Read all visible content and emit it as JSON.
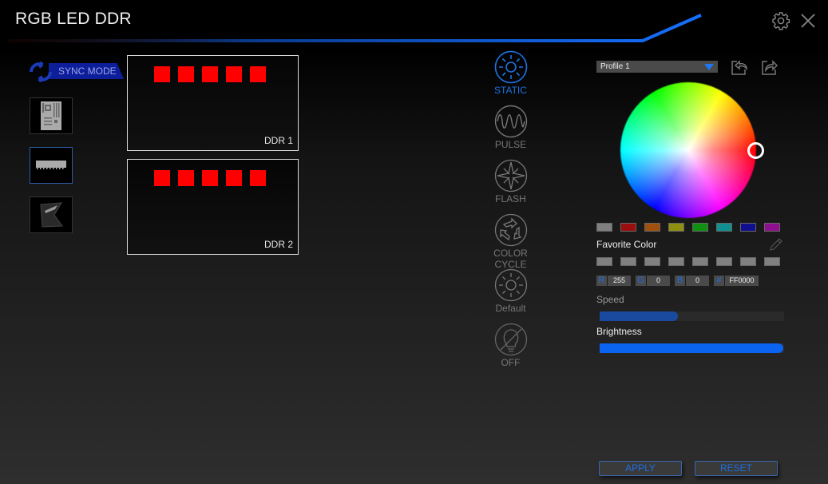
{
  "app": {
    "title": "RGB LED DDR",
    "settings_icon": "gear-icon",
    "close_icon": "close-icon",
    "accent_color": "#1e73e6"
  },
  "sync": {
    "label": "SYNC MODE",
    "icon": "sync-icon"
  },
  "device_tabs": [
    {
      "name": "motherboard",
      "icon": "motherboard-icon",
      "active": false
    },
    {
      "name": "memory",
      "icon": "ram-module-icon",
      "active": true
    },
    {
      "name": "peripheral",
      "icon": "peripheral-icon",
      "active": false
    }
  ],
  "ddr_panels": [
    {
      "label": "DDR 1",
      "led_count": 5,
      "led_color": "#FF0000"
    },
    {
      "label": "DDR 2",
      "led_count": 5,
      "led_color": "#FF0000"
    }
  ],
  "modes": [
    {
      "label": "STATIC",
      "icon": "sun-icon",
      "active": true
    },
    {
      "label": "PULSE",
      "icon": "wave-icon",
      "active": false
    },
    {
      "label": "FLASH",
      "icon": "star-burst-icon",
      "active": false
    },
    {
      "label": "COLOR\nCYCLE",
      "label_line1": "COLOR",
      "label_line2": "CYCLE",
      "icon": "cycle-arrows-icon",
      "active": false
    },
    {
      "label": "Default",
      "icon": "sun-outline-icon",
      "active": false
    },
    {
      "label": "OFF",
      "icon": "bulb-off-icon",
      "active": false
    }
  ],
  "profile": {
    "selected": "Profile 1",
    "import_icon": "import-icon",
    "export_icon": "export-icon"
  },
  "color_picker": {
    "selected_hex": "#FF0000",
    "preset_colors": [
      "#7f7f7f",
      "#9a0e0e",
      "#a0500e",
      "#8f8f10",
      "#109010",
      "#109090",
      "#10108f",
      "#8f108f"
    ],
    "favorite_label": "Favorite Color",
    "favorite_colors": [
      "#808080",
      "#808080",
      "#808080",
      "#808080",
      "#808080",
      "#808080",
      "#808080",
      "#808080"
    ],
    "edit_icon": "pencil-icon",
    "r_label": "R",
    "r": "255",
    "g_label": "G",
    "g": "0",
    "b_label": "B",
    "b": "0",
    "hex_label": "#",
    "hex": "FF0000"
  },
  "speed": {
    "label": "Speed",
    "value_percent": 40,
    "fill_color": "#1a4aa0",
    "knob_color": "#1a4aa0",
    "label_color": "#9a9a9a"
  },
  "brightness": {
    "label": "Brightness",
    "value_percent": 97,
    "fill_color": "#0a64f0",
    "knob_color": "#0a64f0",
    "label_color": "#f0f0f0"
  },
  "buttons": {
    "apply": "APPLY",
    "reset": "RESET"
  }
}
